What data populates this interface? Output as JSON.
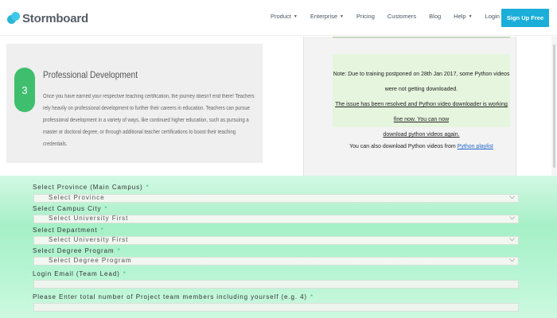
{
  "nav": {
    "logo": "Stormboard",
    "links": [
      {
        "label": "Product",
        "caret": "▼"
      },
      {
        "label": "Enterprise",
        "caret": "▼"
      },
      {
        "label": "Pricing",
        "caret": ""
      },
      {
        "label": "Customers",
        "caret": ""
      },
      {
        "label": "Blog",
        "caret": ""
      },
      {
        "label": "Help",
        "caret": "▼"
      },
      {
        "label": "Login →",
        "caret": ""
      }
    ],
    "signup": "Sign Up Free"
  },
  "card": {
    "step": "3",
    "title": "Professional Development",
    "body": "Once you have earned your respective teaching certification, the journey doesn't end there! Teachers rely heavily on professional development to further their careers in education. Teachers can pursue professional development in a variety of ways, like continued higher education, such as pursuing a master or doctoral degree, or through additional teacher certifications to boost their teaching credentials."
  },
  "notice": {
    "line1": "Note: Due to training postponed on 28th Jan 2017, some Python videos were not getting downloaded.",
    "line2": "The issue has been resolved and Python video downloader is working fine now. You can now",
    "line3": "download python videos again.",
    "download_prefix": "You can also download Python videos from ",
    "download_link": "Python playlist"
  },
  "form": {
    "fields": [
      {
        "label": "Select Province (Main Campus)",
        "required": "*",
        "type": "select",
        "value": "Select Province",
        "chevron": "⌵"
      },
      {
        "label": "Select Campus City",
        "required": "*",
        "type": "select",
        "value": "Select University First",
        "chevron": "⌵"
      },
      {
        "label": "Select Department",
        "required": "*",
        "type": "select",
        "value": "Select University First",
        "chevron": "⌵"
      },
      {
        "label": "Select Degree Program",
        "required": "*",
        "type": "select",
        "value": "Select Degree Program",
        "chevron": "⌵"
      },
      {
        "label": "Login Email (Team Lead)",
        "required": "*",
        "type": "input",
        "value": ""
      },
      {
        "label": "Please Enter total number of Project team members including yourself (e.g. 4)",
        "required": "*",
        "type": "input",
        "value": ""
      }
    ]
  },
  "colors": {
    "accent": "#1aaed9",
    "step_green": "#3fbf6d",
    "form_green": "#a6f0c7",
    "notice_bg": "#e6f5de"
  }
}
